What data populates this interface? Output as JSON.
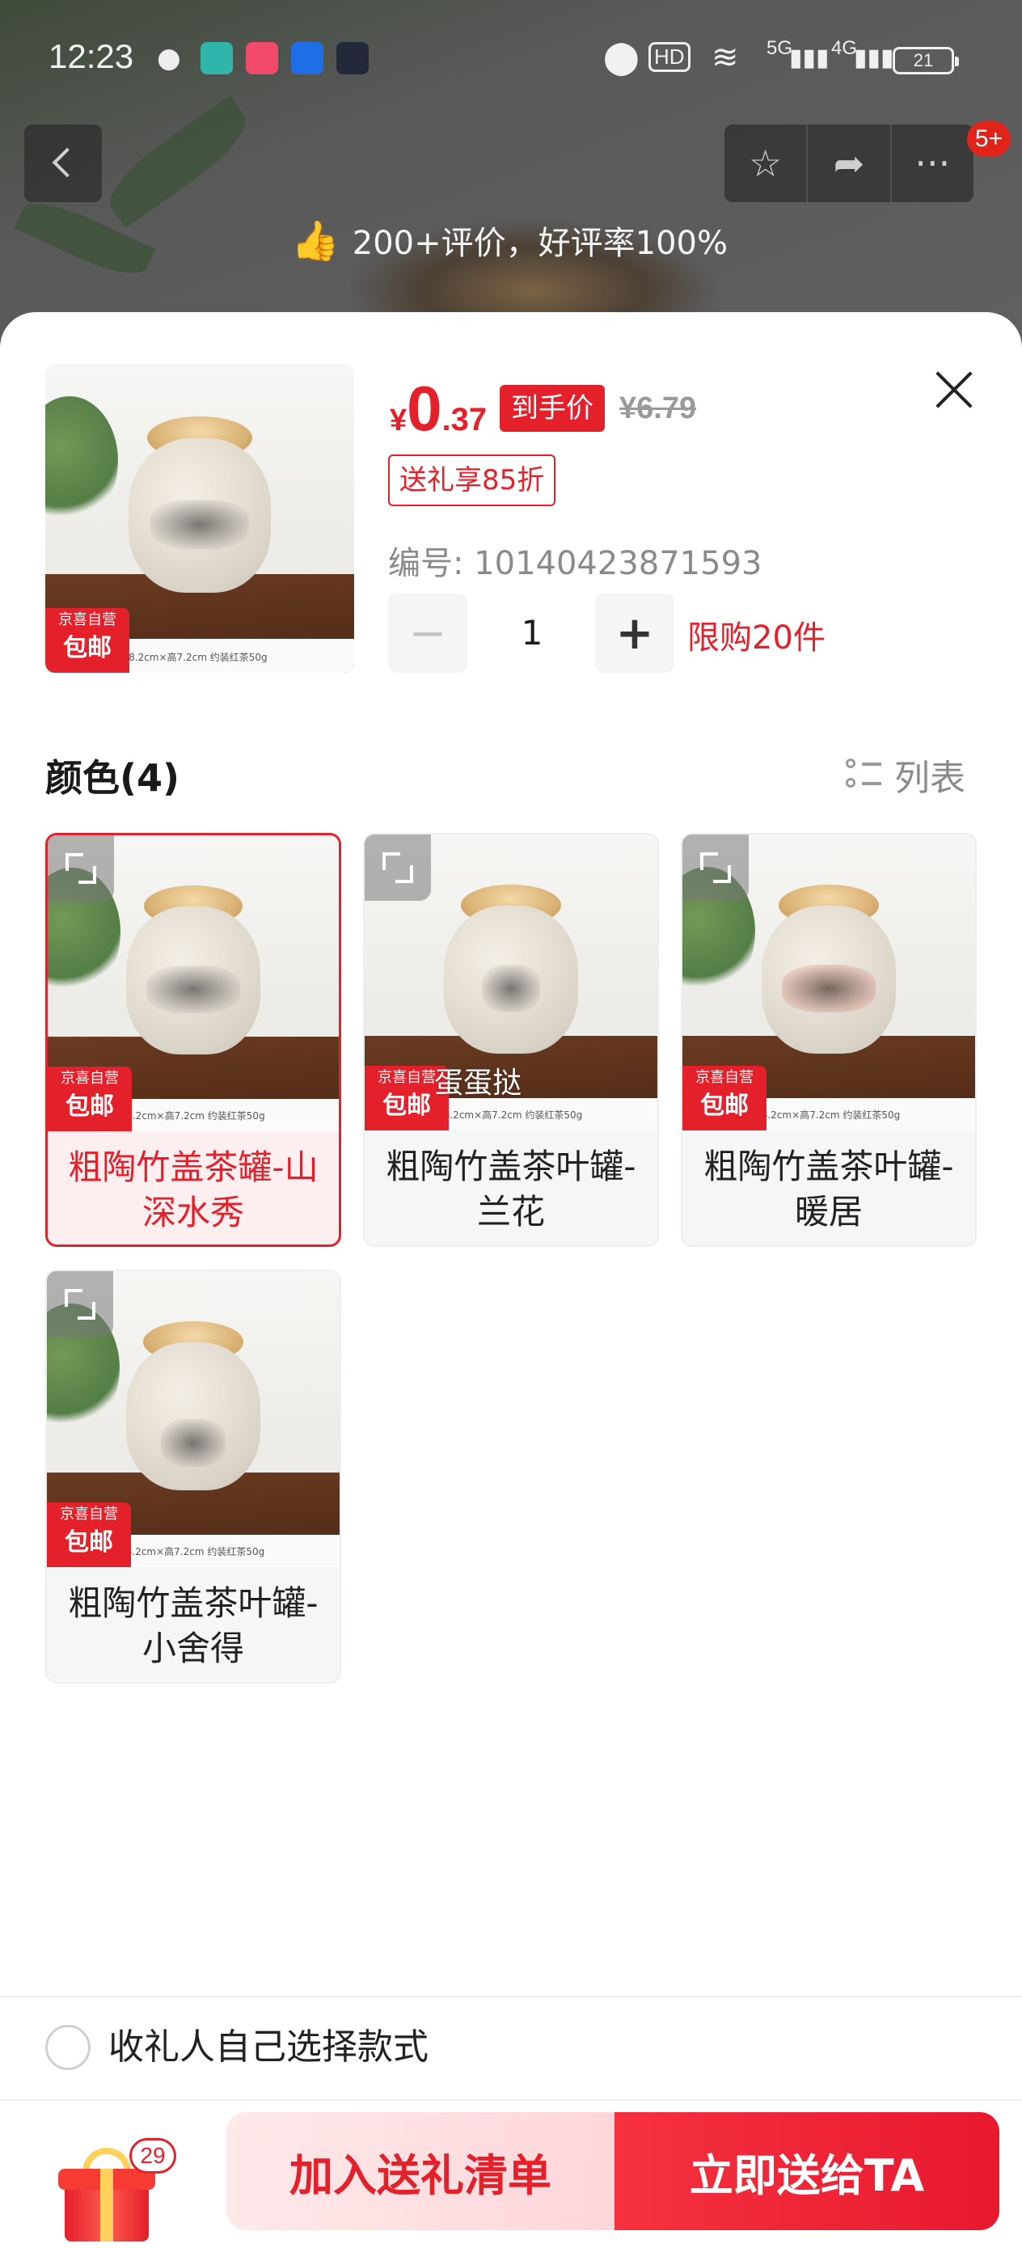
{
  "status_bar": {
    "time": "12:23",
    "network_5g": "5G",
    "network_4g": "4G",
    "battery": "21"
  },
  "top_nav": {
    "more_badge": "5+",
    "review_text": "200+评价，好评率100%"
  },
  "product": {
    "price_currency": "¥",
    "price_integer": "0",
    "price_decimal": ".37",
    "price_tag": "到手价",
    "original_price": "¥6.79",
    "gift_discount": "送礼享85折",
    "sku_label": "编号: 10140423871593",
    "quantity": "1",
    "limit_text": "限购20件",
    "jd_badge_top": "京喜自营",
    "jd_badge_bottom": "包邮",
    "dimension_text": "8.2cm×高7.2cm 约装红茶50g"
  },
  "color_section": {
    "title": "颜色(4)",
    "list_toggle": "列表",
    "options": [
      {
        "name": "粗陶竹盖茶罐-山深水秀",
        "selected": true
      },
      {
        "name": "粗陶竹盖茶叶罐-兰花",
        "selected": false,
        "overlay_text": "蛋蛋挞"
      },
      {
        "name": "粗陶竹盖茶叶罐-暖居",
        "selected": false
      },
      {
        "name": "粗陶竹盖茶叶罐-小舍得",
        "selected": false
      }
    ]
  },
  "recipient_option": {
    "label": "收礼人自己选择款式",
    "checked": false
  },
  "bottom_bar": {
    "gift_count": "29",
    "add_button": "加入送礼清单",
    "send_button": "立即送给TA"
  },
  "colors": {
    "accent": "#e4202a",
    "selected_bg": "#fdeef0"
  }
}
